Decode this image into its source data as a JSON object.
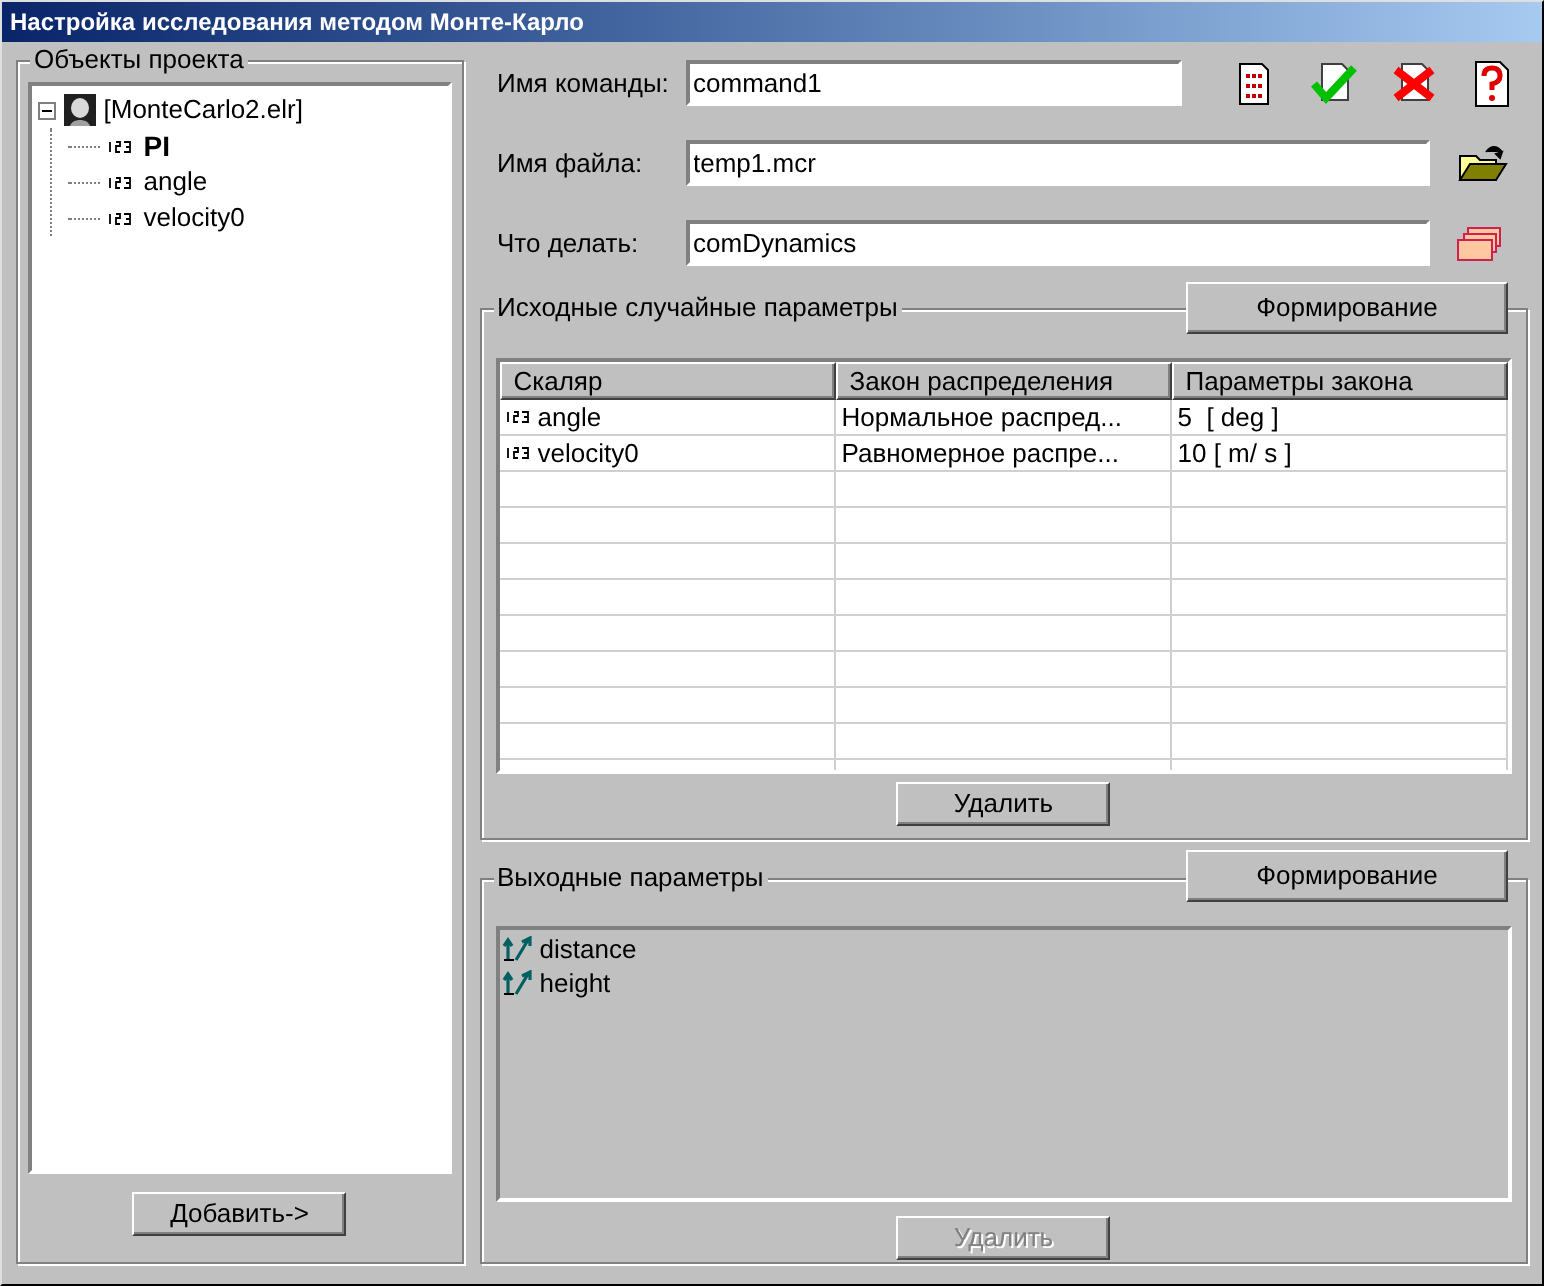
{
  "window": {
    "title": "Настройка исследования методом Монте-Карло"
  },
  "project_objects": {
    "title": "Объекты проекта",
    "tree": [
      {
        "label": "[MonteCarlo2.elr]",
        "kind": "file",
        "expanded": true,
        "bold": false,
        "children": [
          {
            "label": "PI",
            "kind": "scalar",
            "bold": true
          },
          {
            "label": "angle",
            "kind": "scalar",
            "bold": false
          },
          {
            "label": "velocity0",
            "kind": "scalar",
            "bold": false
          }
        ]
      }
    ],
    "add_button": {
      "label": "Добавить->",
      "disabled": false
    }
  },
  "fields": [
    {
      "label": "Имя команды:",
      "value": "command1",
      "kind": "toolbar"
    },
    {
      "label": "Имя файла:",
      "value": "temp1.mcr",
      "kind": "open"
    },
    {
      "label": "Что делать:",
      "value": "comDynamics",
      "kind": "stack"
    }
  ],
  "input_params": {
    "title": "Исходные случайные параметры",
    "form_button": {
      "label": "Формирование",
      "disabled": false
    },
    "table": {
      "columns": [
        "Скаляр",
        "Закон распределения",
        "Параметры закона"
      ],
      "rows": [
        {
          "cells": [
            "angle",
            "Нормальное распред...",
            "5  [ deg ]"
          ]
        },
        {
          "cells": [
            "velocity0",
            "Равномерное распре...",
            "10 [ m/ s ]"
          ]
        }
      ]
    },
    "delete_button": {
      "label": "Удалить",
      "disabled": false
    }
  },
  "output_params": {
    "title": "Выходные параметры",
    "form_button": {
      "label": "Формирование",
      "disabled": false
    },
    "items": [
      {
        "label": "distance"
      },
      {
        "label": "height"
      }
    ],
    "delete_button": {
      "label": "Удалить",
      "disabled": true
    }
  }
}
